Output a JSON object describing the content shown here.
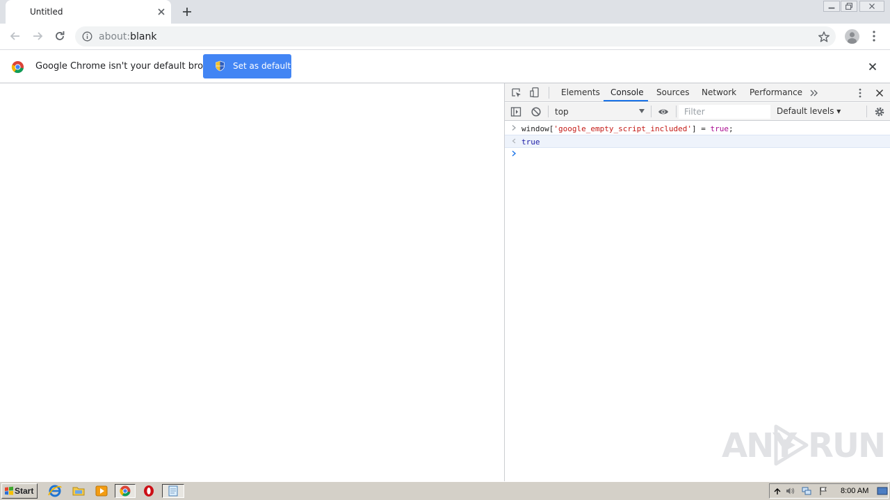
{
  "tab": {
    "title": "Untitled"
  },
  "address": {
    "scheme": "about:",
    "rest": "blank"
  },
  "infobar": {
    "message": "Google Chrome isn't your default browser",
    "button": "Set as default"
  },
  "devtools": {
    "tabs": [
      "Elements",
      "Console",
      "Sources",
      "Network",
      "Performance"
    ],
    "active_tab": "Console",
    "context": "top",
    "filter_placeholder": "Filter",
    "levels": "Default levels",
    "console": {
      "input_code": {
        "prefix": "window[",
        "string": "'google_empty_script_included'",
        "mid": "] = ",
        "value": "true",
        "suffix": ";"
      },
      "result": "true"
    }
  },
  "watermark": {
    "left": "ANY",
    "right": "RUN"
  },
  "taskbar": {
    "start_label": "Start",
    "clock": "8:00 AM"
  },
  "colors": {
    "accent": "#4285f4",
    "devtools_active": "#1a73e8",
    "tab_strip": "#dee1e6",
    "taskbar": "#d4d0c8"
  },
  "icons": {
    "toolbar": [
      "back-arrow-icon",
      "forward-arrow-icon",
      "reload-icon",
      "info-icon",
      "star-icon",
      "profile-icon",
      "menu-kebab-icon"
    ],
    "taskbar": [
      "ie-icon",
      "explorer-folder-icon",
      "media-player-icon",
      "chrome-icon",
      "opera-icon",
      "notepad-icon"
    ]
  }
}
